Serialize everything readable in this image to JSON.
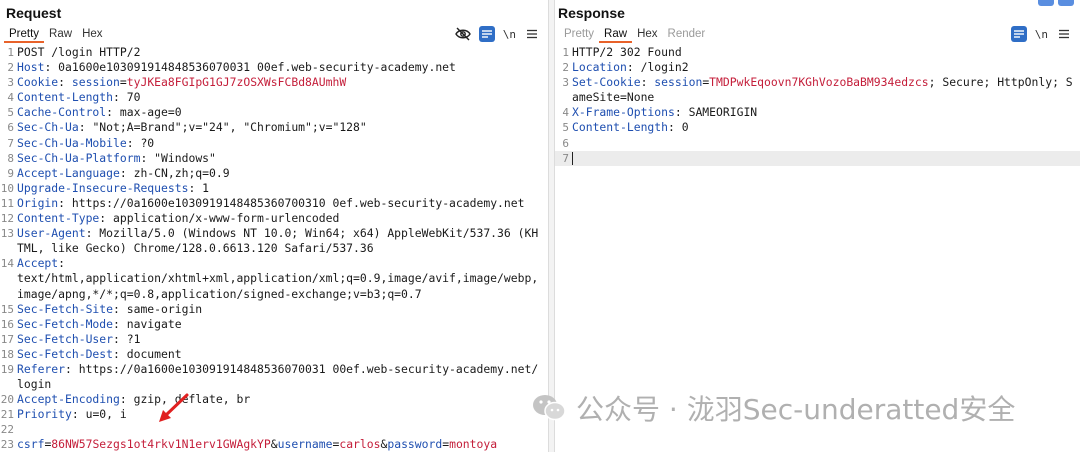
{
  "request": {
    "title": "Request",
    "tabs": [
      {
        "label": "Pretty",
        "active": true
      },
      {
        "label": "Raw",
        "active": false
      },
      {
        "label": "Hex",
        "active": false
      }
    ],
    "toolbar": {
      "newline_label": "\\n"
    },
    "lines": [
      {
        "n": "1",
        "segs": [
          {
            "t": "POST /login HTTP/2",
            "c": ""
          }
        ]
      },
      {
        "n": "2",
        "segs": [
          {
            "t": "Host",
            "c": "hn"
          },
          {
            "t": ": 0a1600e103091914848536070031 00ef.web-security-academy.net",
            "c": ""
          }
        ]
      },
      {
        "n": "3",
        "segs": [
          {
            "t": "Cookie",
            "c": "hn"
          },
          {
            "t": ": ",
            "c": ""
          },
          {
            "t": "session",
            "c": "cn"
          },
          {
            "t": "=",
            "c": ""
          },
          {
            "t": "tyJKEa8FGIpG1GJ7zOSXWsFCBd8AUmhW",
            "c": "cv"
          }
        ]
      },
      {
        "n": "4",
        "segs": [
          {
            "t": "Content-Length",
            "c": "hn"
          },
          {
            "t": ": 70",
            "c": ""
          }
        ]
      },
      {
        "n": "5",
        "segs": [
          {
            "t": "Cache-Control",
            "c": "hn"
          },
          {
            "t": ": max-age=0",
            "c": ""
          }
        ]
      },
      {
        "n": "6",
        "segs": [
          {
            "t": "Sec-Ch-Ua",
            "c": "hn"
          },
          {
            "t": ": \"Not;A=Brand\";v=\"24\", \"Chromium\";v=\"128\"",
            "c": ""
          }
        ]
      },
      {
        "n": "7",
        "segs": [
          {
            "t": "Sec-Ch-Ua-Mobile",
            "c": "hn"
          },
          {
            "t": ": ?0",
            "c": ""
          }
        ]
      },
      {
        "n": "8",
        "segs": [
          {
            "t": "Sec-Ch-Ua-Platform",
            "c": "hn"
          },
          {
            "t": ": \"Windows\"",
            "c": ""
          }
        ]
      },
      {
        "n": "9",
        "segs": [
          {
            "t": "Accept-Language",
            "c": "hn"
          },
          {
            "t": ": zh-CN,zh;q=0.9",
            "c": ""
          }
        ]
      },
      {
        "n": "10",
        "segs": [
          {
            "t": "Upgrade-Insecure-Requests",
            "c": "hn"
          },
          {
            "t": ": 1",
            "c": ""
          }
        ]
      },
      {
        "n": "11",
        "segs": [
          {
            "t": "Origin",
            "c": "hn"
          },
          {
            "t": ": https://0a1600e1030919148485360700310 0ef.web-security-academy.net",
            "c": ""
          }
        ]
      },
      {
        "n": "12",
        "segs": [
          {
            "t": "Content-Type",
            "c": "hn"
          },
          {
            "t": ": application/x-www-form-urlencoded",
            "c": ""
          }
        ]
      },
      {
        "n": "13",
        "segs": [
          {
            "t": "User-Agent",
            "c": "hn"
          },
          {
            "t": ": Mozilla/5.0 (Windows NT 10.0; Win64; x64) AppleWebKit/537.36 (KHTML, like Gecko) Chrome/128.0.6613.120 Safari/537.36",
            "c": ""
          }
        ]
      },
      {
        "n": "14",
        "segs": [
          {
            "t": "Accept",
            "c": "hn"
          },
          {
            "t": ":\ntext/html,application/xhtml+xml,application/xml;q=0.9,image/avif,image/webp,image/apng,*/*;q=0.8,application/signed-exchange;v=b3;q=0.7",
            "c": ""
          }
        ]
      },
      {
        "n": "15",
        "segs": [
          {
            "t": "Sec-Fetch-Site",
            "c": "hn"
          },
          {
            "t": ": same-origin",
            "c": ""
          }
        ]
      },
      {
        "n": "16",
        "segs": [
          {
            "t": "Sec-Fetch-Mode",
            "c": "hn"
          },
          {
            "t": ": navigate",
            "c": ""
          }
        ]
      },
      {
        "n": "17",
        "segs": [
          {
            "t": "Sec-Fetch-User",
            "c": "hn"
          },
          {
            "t": ": ?1",
            "c": ""
          }
        ]
      },
      {
        "n": "18",
        "segs": [
          {
            "t": "Sec-Fetch-Dest",
            "c": "hn"
          },
          {
            "t": ": document",
            "c": ""
          }
        ]
      },
      {
        "n": "19",
        "segs": [
          {
            "t": "Referer",
            "c": "hn"
          },
          {
            "t": ": https://0a1600e103091914848536070031 00ef.web-security-academy.net/login",
            "c": ""
          }
        ]
      },
      {
        "n": "20",
        "segs": [
          {
            "t": "Accept-Encoding",
            "c": "hn"
          },
          {
            "t": ": gzip, deflate, br",
            "c": ""
          }
        ]
      },
      {
        "n": "21",
        "segs": [
          {
            "t": "Priority",
            "c": "hn"
          },
          {
            "t": ": u=0, i",
            "c": ""
          }
        ]
      },
      {
        "n": "22",
        "segs": []
      },
      {
        "n": "23",
        "segs": [
          {
            "t": "csrf",
            "c": "pn"
          },
          {
            "t": "=",
            "c": ""
          },
          {
            "t": "86NW57Sezgs1ot4rkv1N1erv1GWAgkYP",
            "c": "pv"
          },
          {
            "t": "&",
            "c": ""
          },
          {
            "t": "username",
            "c": "pn"
          },
          {
            "t": "=",
            "c": ""
          },
          {
            "t": "carlos",
            "c": "pv"
          },
          {
            "t": "&",
            "c": ""
          },
          {
            "t": "password",
            "c": "pn"
          },
          {
            "t": "=",
            "c": ""
          },
          {
            "t": "montoya",
            "c": "pv"
          }
        ]
      }
    ]
  },
  "response": {
    "title": "Response",
    "tabs": [
      {
        "label": "Pretty",
        "active": false,
        "muted": true
      },
      {
        "label": "Raw",
        "active": true
      },
      {
        "label": "Hex",
        "active": false
      },
      {
        "label": "Render",
        "active": false,
        "muted": true
      }
    ],
    "lines": [
      {
        "n": "1",
        "segs": [
          {
            "t": "HTTP/2 302 Found",
            "c": ""
          }
        ]
      },
      {
        "n": "2",
        "segs": [
          {
            "t": "Location",
            "c": "hn"
          },
          {
            "t": ": /login2",
            "c": ""
          }
        ]
      },
      {
        "n": "3",
        "segs": [
          {
            "t": "Set-Cookie",
            "c": "hn"
          },
          {
            "t": ": ",
            "c": ""
          },
          {
            "t": "session",
            "c": "cn"
          },
          {
            "t": "=",
            "c": ""
          },
          {
            "t": "TMDPwkEqoovn7KGhVozoBaBM934edzcs",
            "c": "cv"
          },
          {
            "t": "; Secure; HttpOnly; SameSite=None",
            "c": ""
          }
        ]
      },
      {
        "n": "4",
        "segs": [
          {
            "t": "X-Frame-Options",
            "c": "hn"
          },
          {
            "t": ": SAMEORIGIN",
            "c": ""
          }
        ]
      },
      {
        "n": "5",
        "segs": [
          {
            "t": "Content-Length",
            "c": "hn"
          },
          {
            "t": ": 0",
            "c": ""
          }
        ]
      },
      {
        "n": "6",
        "segs": []
      },
      {
        "n": "7",
        "segs": [],
        "cursor": true
      }
    ]
  },
  "watermark": {
    "text": "公众号 · 泷羽Sec-underatted安全"
  },
  "colors": {
    "accent": "#e8622a",
    "header_name": "#1f4fb0",
    "value_red": "#c41e3a",
    "arrow": "#e02020",
    "toolbar_blue": "#2f6ec6"
  }
}
